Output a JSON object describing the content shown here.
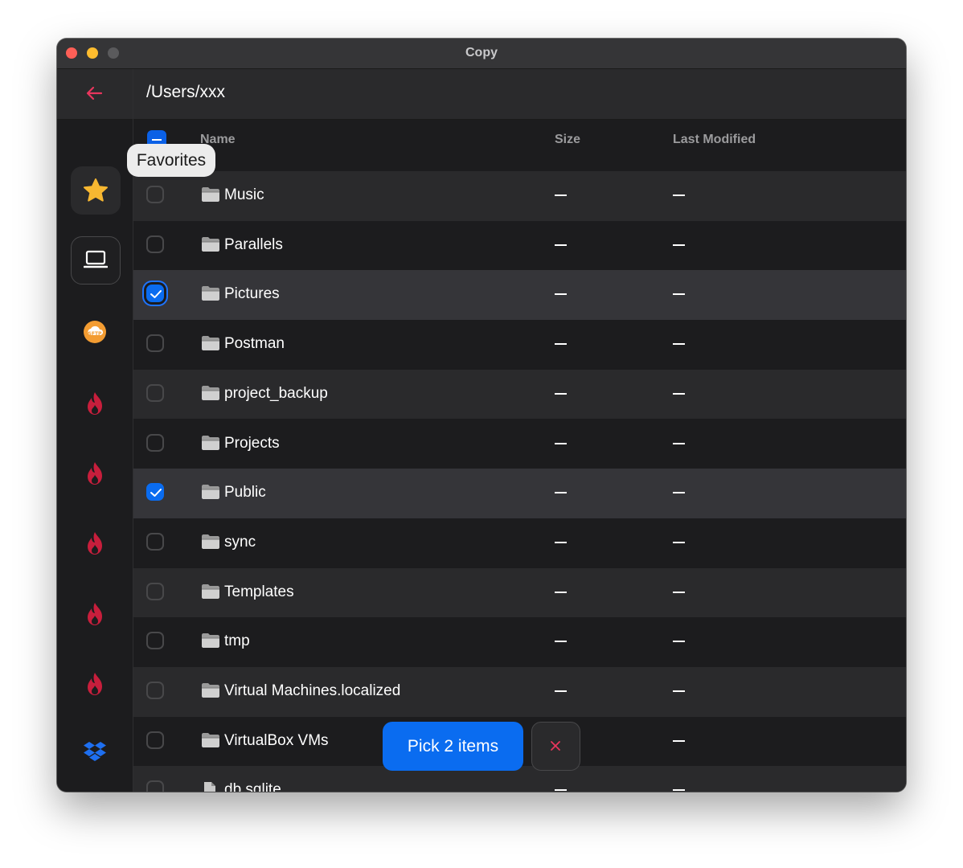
{
  "window": {
    "title": "Copy"
  },
  "path": "/Users/xxx",
  "tooltip": "Favorites",
  "sidebar": {
    "icons": [
      "back-arrow-icon",
      "star-icon",
      "laptop-icon",
      "sftp-icon",
      "flame-icon",
      "flame-icon",
      "flame-icon",
      "flame-icon",
      "flame-icon",
      "dropbox-icon",
      "gift-icon"
    ]
  },
  "table": {
    "headers": {
      "name": "Name",
      "size": "Size",
      "modified": "Last Modified"
    },
    "rows": [
      {
        "name": "Music",
        "size": "—",
        "modified": "—",
        "checked": false,
        "icon": "folder-icon"
      },
      {
        "name": "Parallels",
        "size": "—",
        "modified": "—",
        "checked": false,
        "icon": "folder-icon"
      },
      {
        "name": "Pictures",
        "size": "—",
        "modified": "—",
        "checked": true,
        "icon": "folder-icon"
      },
      {
        "name": "Postman",
        "size": "—",
        "modified": "—",
        "checked": false,
        "icon": "folder-icon"
      },
      {
        "name": "project_backup",
        "size": "—",
        "modified": "—",
        "checked": false,
        "icon": "folder-icon"
      },
      {
        "name": "Projects",
        "size": "—",
        "modified": "—",
        "checked": false,
        "icon": "folder-icon"
      },
      {
        "name": "Public",
        "size": "—",
        "modified": "—",
        "checked": true,
        "icon": "folder-icon"
      },
      {
        "name": "sync",
        "size": "—",
        "modified": "—",
        "checked": false,
        "icon": "folder-icon"
      },
      {
        "name": "Templates",
        "size": "—",
        "modified": "—",
        "checked": false,
        "icon": "folder-icon"
      },
      {
        "name": "tmp",
        "size": "—",
        "modified": "—",
        "checked": false,
        "icon": "folder-icon"
      },
      {
        "name": "Virtual Machines.localized",
        "size": "—",
        "modified": "—",
        "checked": false,
        "icon": "folder-icon"
      },
      {
        "name": "VirtualBox VMs",
        "size": "—",
        "modified": "—",
        "checked": false,
        "icon": "folder-icon"
      },
      {
        "name": "db.sqlite",
        "size": "—",
        "modified": "—",
        "checked": false,
        "icon": "file-icon"
      }
    ]
  },
  "actions": {
    "pick_label": "Pick 2 items"
  },
  "colors": {
    "accent": "#0a6cf0",
    "back_arrow": "#e8365d",
    "star": "#f7b731",
    "window_bg": "#1c1c1e"
  }
}
